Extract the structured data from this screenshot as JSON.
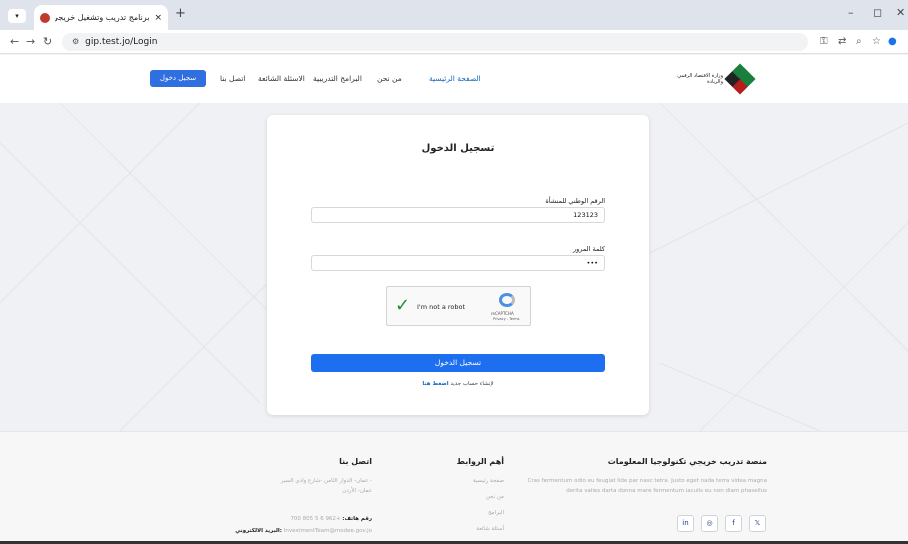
{
  "browser": {
    "tab_title": "برنامج تدريب وتشغيل خريجي الات",
    "tab_close": "×",
    "new_tab": "+",
    "tab_menu": "▾",
    "url": "gip.test.jo/Login",
    "win_min": "–",
    "win_max": "◻",
    "win_close": "✕"
  },
  "nav": {
    "logo_text": "وزارة الاقتصاد الرقمي والريادة",
    "items": [
      "الصفحة الرئيسية",
      "من نحن",
      "البرامج التدريبية",
      "الاسئلة الشائعة",
      "اتصل بنا"
    ],
    "register_label": "سجيل دخول"
  },
  "login": {
    "title": "تسجيل الدخول",
    "national_id_label": "الرقم الوطني للمنشأة",
    "national_id_value": "123123",
    "password_label": "كلمة المرور",
    "password_value": "•••",
    "captcha_text": "I'm not a robot",
    "captcha_brand": "reCAPTCHA",
    "captcha_links": "Privacy - Terms",
    "submit_label": "تسجيل الدخول",
    "signup_text": "لإنشاء حساب جديد",
    "signup_link": "اضغط هنا"
  },
  "footer": {
    "brand_title": "منصة تدريب خريجي تكنولوجيا المعلومات",
    "brand_desc_1": "Cras fermentum odio eu feugiat lide par nasc tetra. Justo eget nada terra videa magna",
    "brand_desc_2": "derita valies darta donna mare fermentum iaculis eu non diam phasellus",
    "links_title": "أهم الروابط",
    "links": [
      "صفحة رئيسية",
      "من نحن",
      "البرامج",
      "أسئلة شائعة"
    ],
    "contact_title": "اتصل بنا",
    "address_1": "عمان- الدوار الثامن -شارع وادي السير -",
    "address_2": "عمان- الأردن",
    "phone_label": "رقم هاتف:",
    "phone_value": "+962 6 5 805 700",
    "email_label": "البريد الالكتروني:",
    "email_value": "InvestmentTeam@modee.gov.jo"
  }
}
